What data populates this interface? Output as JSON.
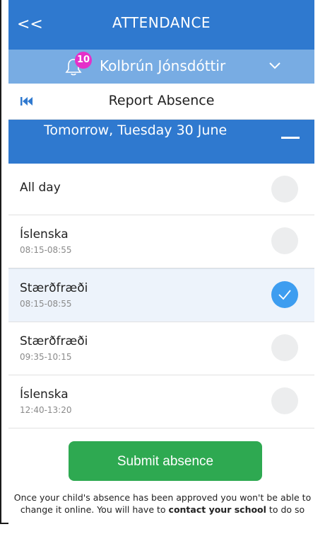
{
  "header": {
    "back_label": "<<",
    "title": "ATTENDANCE"
  },
  "user": {
    "notification_count": "10",
    "name": "Kolbrún Jónsdóttir"
  },
  "report": {
    "title": "Report Absence"
  },
  "date_bar": {
    "label": "Tomorrow, Tuesday 30 June"
  },
  "options": [
    {
      "label": "All day",
      "time": "",
      "selected": false
    },
    {
      "label": "Íslenska",
      "time": "08:15-08:55",
      "selected": false
    },
    {
      "label": "Stærðfræði",
      "time": "08:15-08:55",
      "selected": true
    },
    {
      "label": "Stærðfræði",
      "time": "09:35-10:15",
      "selected": false
    },
    {
      "label": "Íslenska",
      "time": "12:40-13:20",
      "selected": false
    }
  ],
  "submit": {
    "label": "Submit absence"
  },
  "note": {
    "part1": "Once your child's absence has been approved you won't be able to change it online. You will have to",
    "bold": "contact your school",
    "part2": "to do so"
  },
  "colors": {
    "primary": "#2f79cf",
    "secondary": "#78ace3",
    "badge": "#e52fc9",
    "success": "#2ea951",
    "check": "#3d9df0"
  }
}
